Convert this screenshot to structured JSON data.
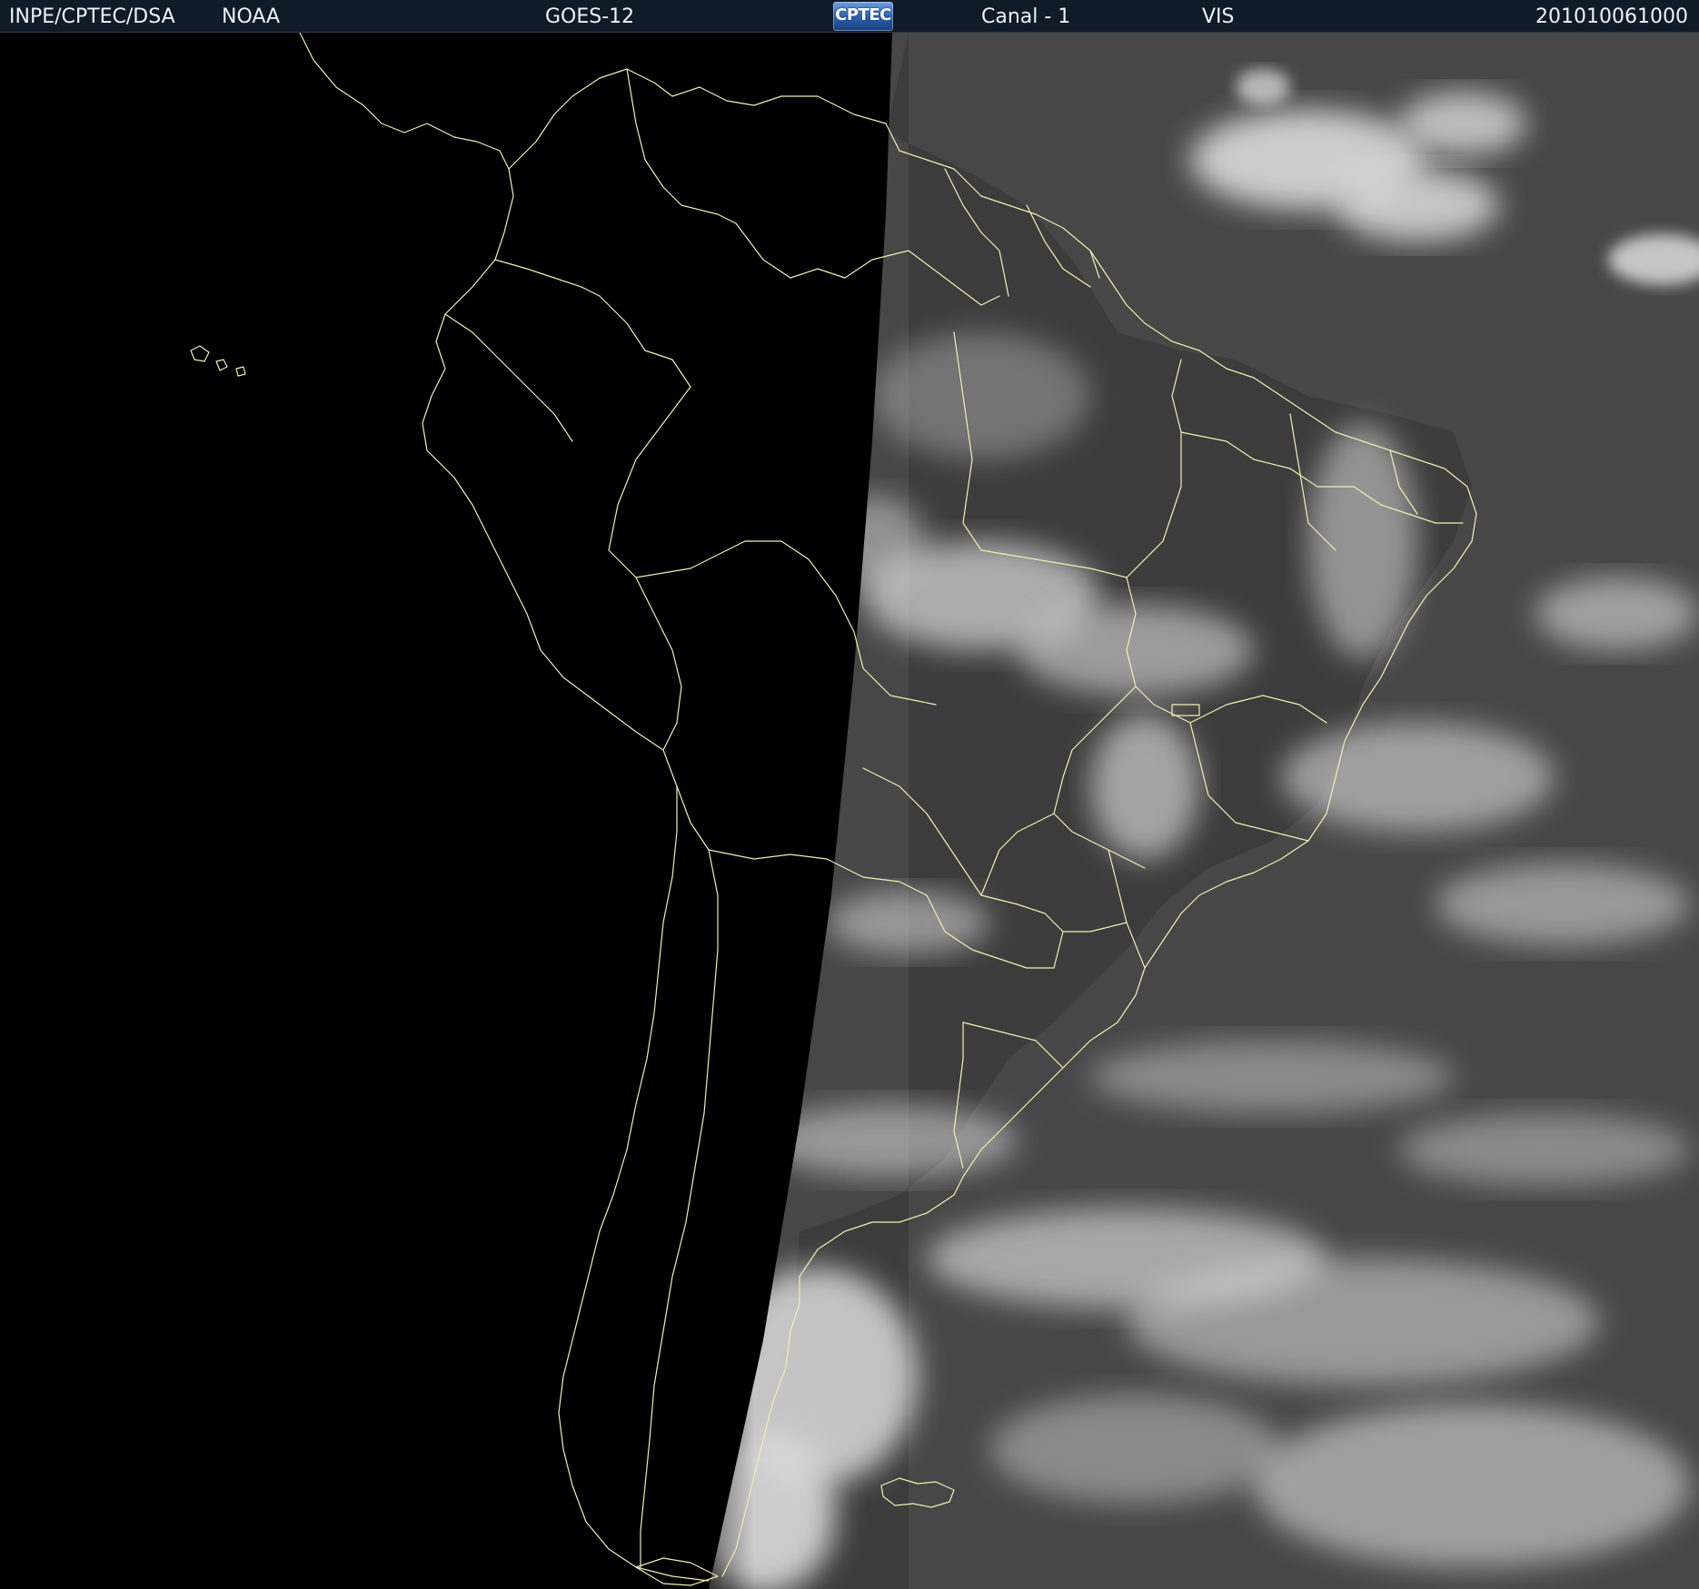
{
  "header": {
    "agency": "INPE/CPTEC/DSA",
    "source": "NOAA",
    "satellite": "GOES-12",
    "logo": "CPTEC",
    "channel": "Canal - 1",
    "band": "VIS",
    "timestamp": "201010061000"
  },
  "map": {
    "region": "south-america",
    "colors": {
      "night": "#000000",
      "ocean_day": "#474747",
      "land_day": "#3b3b3b",
      "cloud": "#d9d9d9",
      "border": "#f0f0b0"
    }
  }
}
